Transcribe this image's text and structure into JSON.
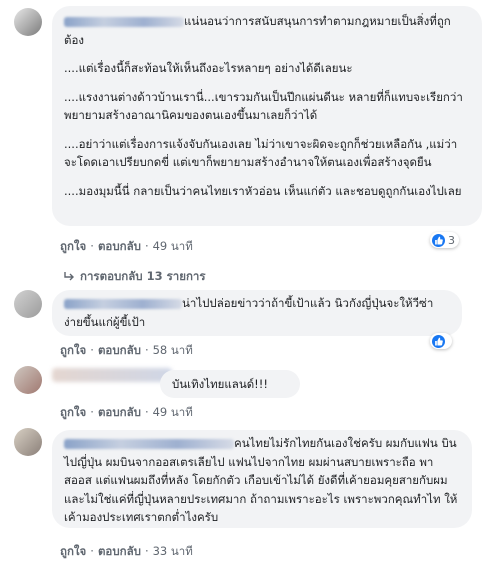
{
  "comments": [
    {
      "paragraphs": [
        "แน่นอนว่าการสนับสนุนการทำตามกฎหมายเป็นสิ่งที่ถูกต้อง",
        "....แต่เรื่องนี้ก็สะท้อนให้เห็นถึงอะไรหลายๆ อย่างได้ดีเลยนะ",
        "....แรงงานต่างด้าวบ้านเรานี่...เขารวมกันเป็นปึกแผ่นดีนะ หลายที่ก็แทบจะเรียกว่าพยายามสร้างอาณานิคมของตนเองขึ้นมาเลยก็ว่าได้",
        "....อย่าว่าแต่เรื่องการแจ้งจับกันเองเลย ไม่ว่าเขาจะผิดจะถูกก็ช่วยเหลือกัน ,แม่ว่าจะโดดเอาเปรียบกดขี่ แต่เขาก็พยายามสร้างอำนาจให้ตนเองเพื่อสร้างจุดยืน",
        "....มองมุมนี้นี่ กลายเป็นว่าคนไทยเราหัวอ่อน เห็นแก่ตัว และชอบดูถูกกันเองไปเลย"
      ],
      "like": "ถูกใจ",
      "reply": "ตอบกลับ",
      "time": "49 นาที",
      "reaction_count": "3",
      "replies_label": "การตอบกลับ 13 รายการ"
    },
    {
      "paragraphs": [
        "น่าไปปล่อยข่าวว่าถ้าขี้เป้าแล้ว นิวกังญี่ปุ่นจะให้วีซ่าง่ายขึ้นแก่ผู้ขี้เป้า"
      ],
      "like": "ถูกใจ",
      "reply": "ตอบกลับ",
      "time": "58 นาที"
    },
    {
      "paragraphs": [
        "บันเทิงไทยแลนด์!!!"
      ],
      "like": "ถูกใจ",
      "reply": "ตอบกลับ",
      "time": "49 นาที"
    },
    {
      "paragraphs": [
        "คนไทยไม่รักไทยกันเองใช่ครับ ผมกับแฟน บินไปญี่ปุ่น ผมบินจากออสเตรเลียไป แฟนไปจากไทย ผมผ่านสบายเพราะถือ พาสออส แต่แฟนผมถึงที่หลัง โดยกักตัว เกือบเข้าไม่ได้ ยังดีที่เค้ายอมคุยสายกับผม และไม่ใช่แค่ที่ญี่ปุ่นหลายประเทศมาก ถ้าถามเพราะอะไร เพราะพวกคุณทำไท ให้เค้ามองประเทศเราตกต่ำไงครับ"
      ],
      "like": "ถูกใจ",
      "reply": "ตอบกลับ",
      "time": "33 นาที"
    }
  ],
  "separator": "·",
  "colors": {
    "like_blue": "#1877f2",
    "bubble": "#f2f3f5",
    "meta": "#606770"
  },
  "icons": {
    "reaction": "thumbs-up-icon",
    "reply_arrow": "reply-arrow-icon"
  }
}
